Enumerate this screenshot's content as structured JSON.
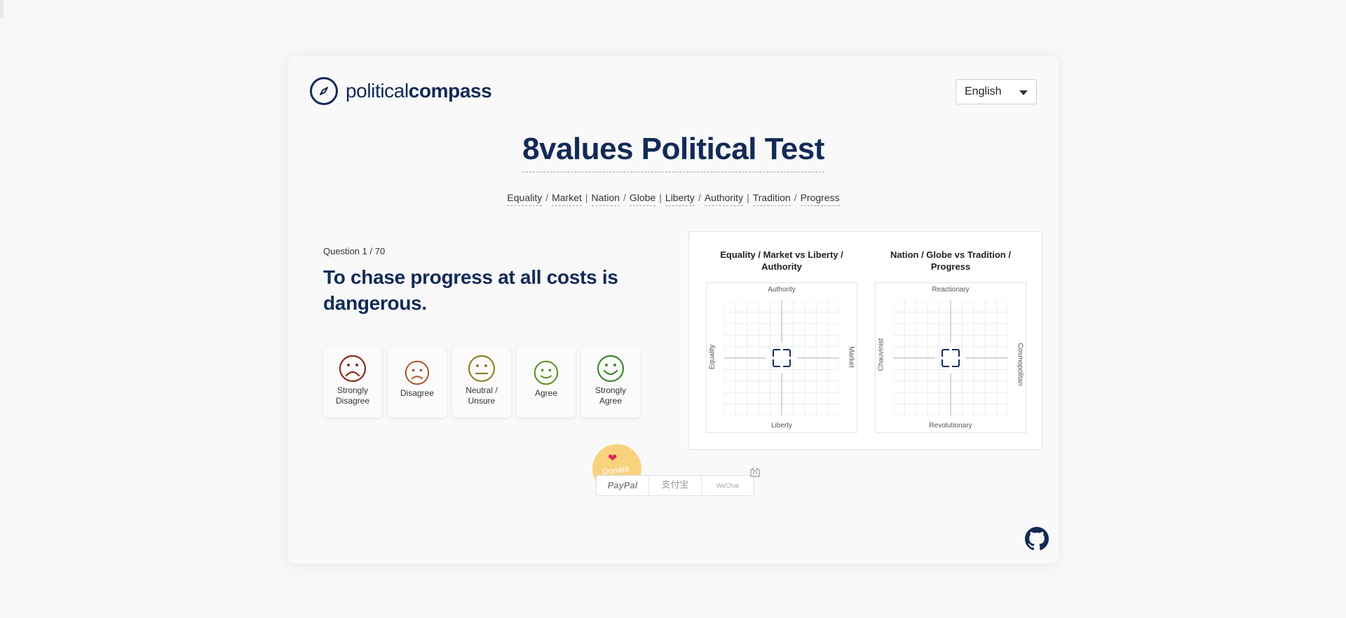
{
  "header": {
    "logo_word1": "political",
    "logo_word2": "compass",
    "language": "English"
  },
  "title": "8values Political Test",
  "axes": [
    "Equality",
    "Market",
    "Nation",
    "Globe",
    "Liberty",
    "Authority",
    "Tradition",
    "Progress"
  ],
  "axes_separators": [
    "/",
    "|",
    "/",
    "|",
    "/",
    "|",
    "/"
  ],
  "question": {
    "counter": "Question 1 / 70",
    "text": "To chase progress at all costs is dangerous."
  },
  "answers": [
    {
      "label": "Strongly Disagree",
      "line1": "Strongly",
      "line2": "Disagree",
      "color": "#8b2a1d",
      "mood": "very-sad"
    },
    {
      "label": "Disagree",
      "line1": "Disagree",
      "line2": "",
      "color": "#a8532c",
      "mood": "sad"
    },
    {
      "label": "Neutral / Unsure",
      "line1": "Neutral /",
      "line2": "Unsure",
      "color": "#8a8226",
      "mood": "neutral"
    },
    {
      "label": "Agree",
      "line1": "Agree",
      "line2": "",
      "color": "#5d8a1e",
      "mood": "happy"
    },
    {
      "label": "Strongly Agree",
      "line1": "Strongly",
      "line2": "Agree",
      "color": "#3f8a2e",
      "mood": "very-happy"
    }
  ],
  "charts": [
    {
      "title": "Equality / Market vs Liberty / Authority",
      "top": "Authority",
      "bottom": "Liberty",
      "left": "Equality",
      "right": "Market"
    },
    {
      "title": "Nation / Globe vs Tradition / Progress",
      "top": "Reactionary",
      "bottom": "Revolutionary",
      "left": "Chauvinist",
      "right": "Cosmopolitan"
    }
  ],
  "donate": {
    "label": "Donate",
    "options": [
      "PayPal",
      "支付宝",
      "WeChat"
    ]
  },
  "colors": {
    "brand": "#132a57",
    "donate_bg": "#f9d27e",
    "heart": "#e0285a"
  },
  "icons": [
    "compass-icon",
    "chevron-down-icon",
    "heart-icon",
    "cat-icon",
    "github-icon"
  ]
}
